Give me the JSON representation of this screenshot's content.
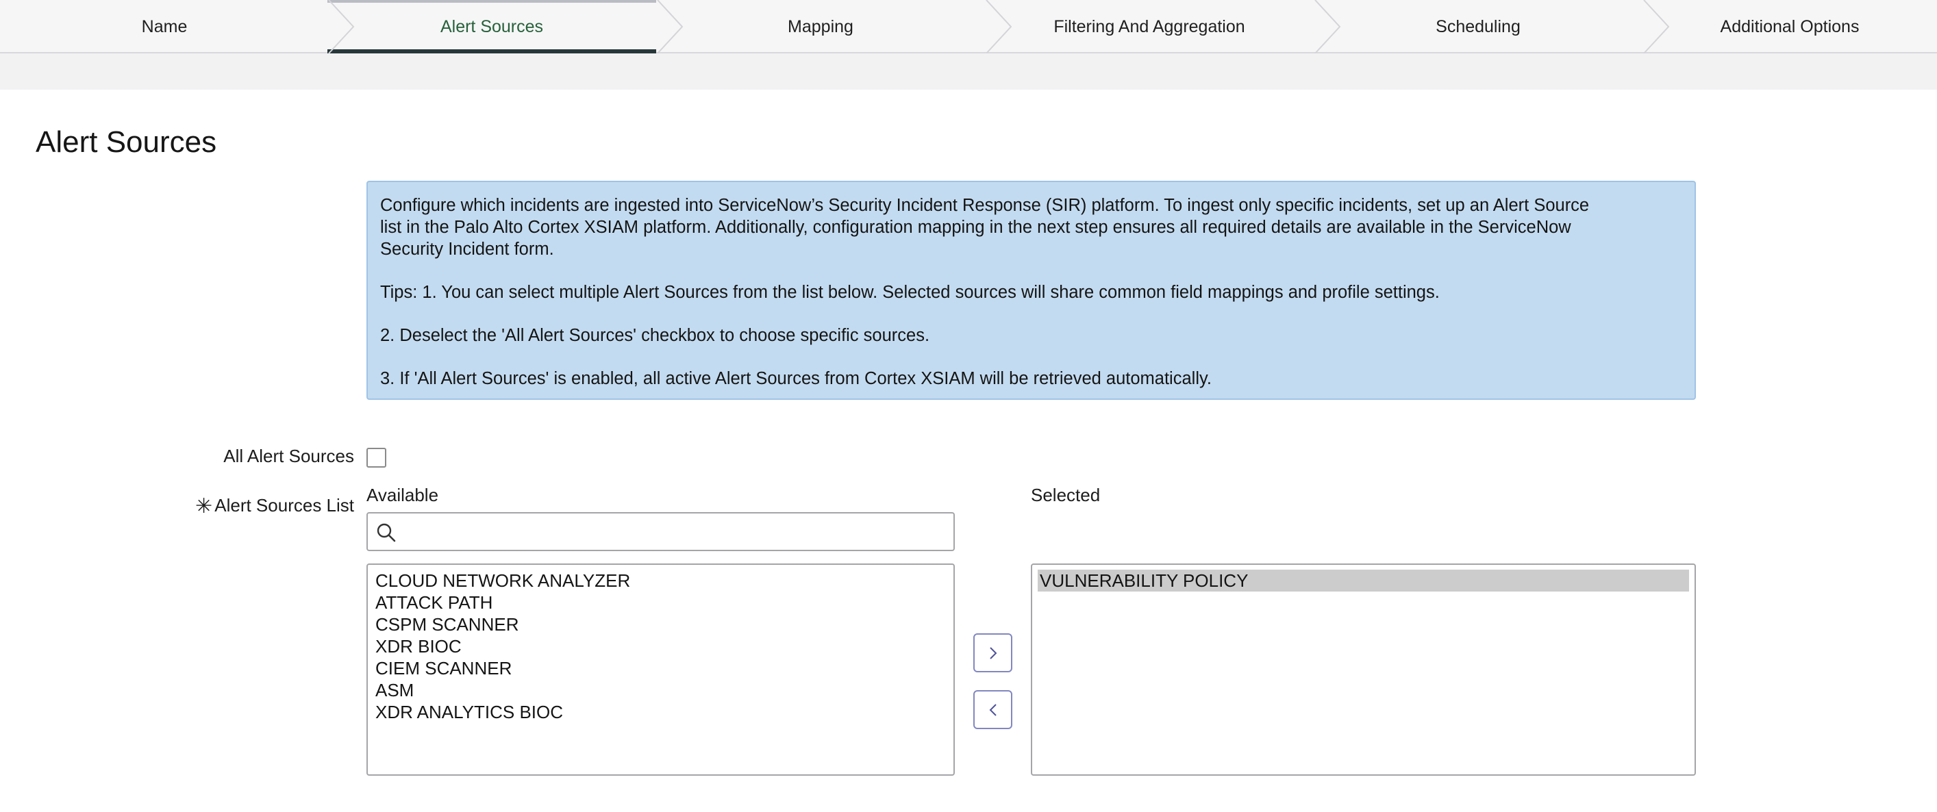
{
  "wizard": {
    "steps": [
      {
        "label": "Name",
        "active": false
      },
      {
        "label": "Alert Sources",
        "active": true
      },
      {
        "label": "Mapping",
        "active": false
      },
      {
        "label": "Filtering And Aggregation",
        "active": false
      },
      {
        "label": "Scheduling",
        "active": false
      },
      {
        "label": "Additional Options",
        "active": false
      }
    ],
    "active_color": "#27613a",
    "active_underline_color": "#28383a"
  },
  "page": {
    "title": "Alert Sources"
  },
  "info_box": {
    "paragraphs": [
      "Configure which incidents are ingested into ServiceNow’s Security Incident Response (SIR) platform. To ingest only specific incidents, set up an Alert Source list in the Palo Alto Cortex XSIAM platform. Additionally, configuration mapping in the next step ensures all required details are available in the ServiceNow Security Incident form.",
      "Tips: 1. You can select multiple Alert Sources from the list below. Selected sources will share common field mappings and profile settings.",
      "2. Deselect the 'All Alert Sources' checkbox to choose specific sources.",
      "3. If 'All Alert Sources' is enabled, all active Alert Sources from Cortex XSIAM will be retrieved automatically."
    ],
    "background": "#c3dbf0"
  },
  "form": {
    "all_sources_label": "All Alert Sources",
    "all_sources_checked": false,
    "list_label": "Alert Sources List",
    "required_mark": "✳",
    "available_heading": "Available",
    "selected_heading": "Selected",
    "search_value": "",
    "search_placeholder": "",
    "search_icon": "search-icon",
    "available_items": [
      "CLOUD NETWORK ANALYZER",
      "ATTACK PATH",
      "CSPM SCANNER",
      "XDR BIOC",
      "CIEM SCANNER",
      "ASM",
      "XDR ANALYTICS BIOC"
    ],
    "selected_items": [
      "VULNERABILITY POLICY"
    ],
    "add_button_icon": "chevron-right-icon",
    "remove_button_icon": "chevron-left-icon"
  }
}
